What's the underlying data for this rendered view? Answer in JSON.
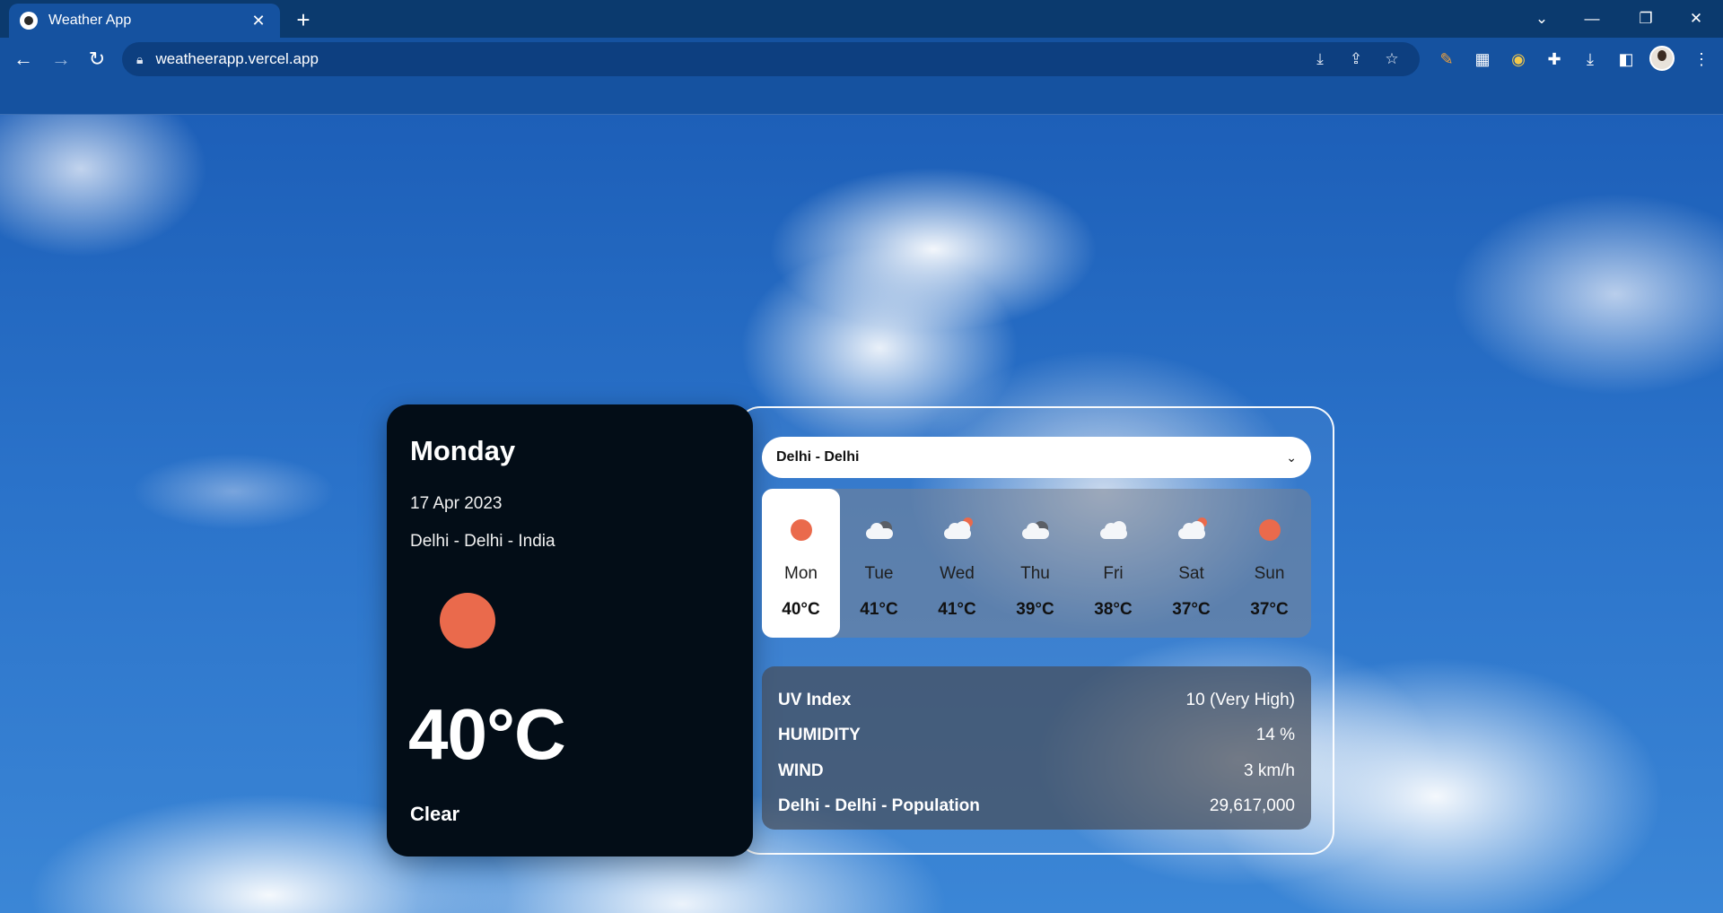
{
  "browser": {
    "tab_title": "Weather App",
    "new_tab": "+",
    "url": "weatheerapp.vercel.app"
  },
  "icons": {
    "back": "arrow-left",
    "forward": "arrow-right",
    "reload": "reload",
    "lock": "lock",
    "install": "install-app",
    "share": "share",
    "bookmark": "star",
    "extensions": [
      "pen-extension",
      "calendar-extension",
      "chrome-extension",
      "puzzle-extensions"
    ],
    "download": "download",
    "side_panel": "side-panel",
    "menu": "more-vertical"
  },
  "weather": {
    "day_name": "Monday",
    "date": "17 Apr 2023",
    "location": "Delhi - Delhi - India",
    "temperature": "40°C",
    "condition": "Clear",
    "sun_color": "#ea6a4c"
  },
  "city_select": {
    "selected": "Delhi - Delhi"
  },
  "forecast": [
    {
      "day": "Mon",
      "temp": "40°C",
      "icon": "sun",
      "active": true
    },
    {
      "day": "Tue",
      "temp": "41°C",
      "icon": "cloud-dark"
    },
    {
      "day": "Wed",
      "temp": "41°C",
      "icon": "cloud-sun-rain"
    },
    {
      "day": "Thu",
      "temp": "39°C",
      "icon": "cloud-dark"
    },
    {
      "day": "Fri",
      "temp": "38°C",
      "icon": "cloud"
    },
    {
      "day": "Sat",
      "temp": "37°C",
      "icon": "cloud-sun"
    },
    {
      "day": "Sun",
      "temp": "37°C",
      "icon": "sun"
    }
  ],
  "stats": [
    {
      "label": "UV Index",
      "value": "10 (Very High)"
    },
    {
      "label": "HUMIDITY",
      "value": "14 %"
    },
    {
      "label": "WIND",
      "value": "3 km/h"
    },
    {
      "label": "Delhi - Delhi - Population",
      "value": "29,617,000"
    }
  ]
}
